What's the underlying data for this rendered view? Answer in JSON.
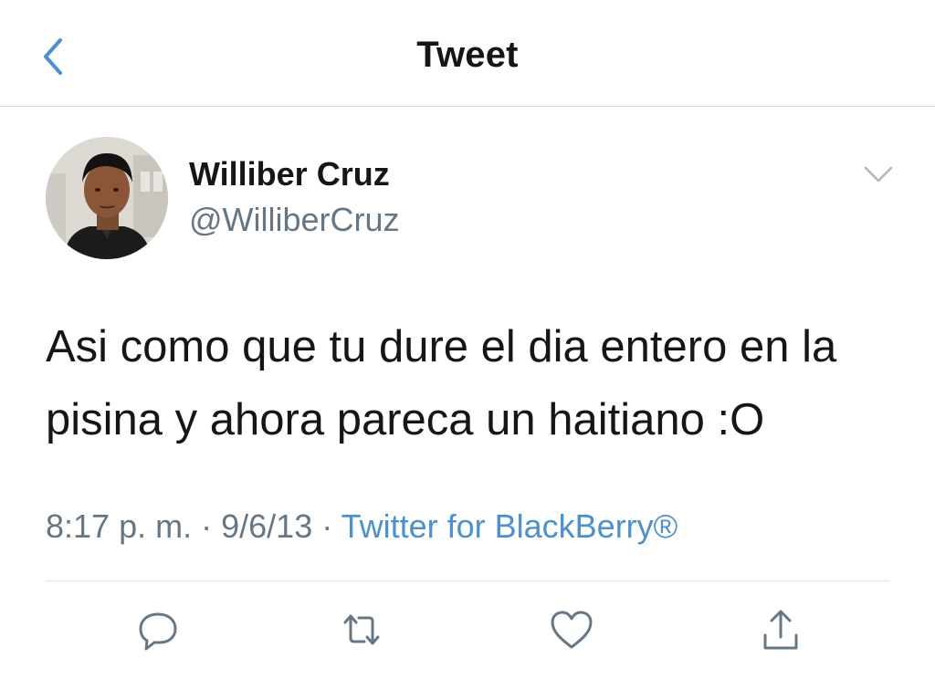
{
  "header": {
    "title": "Tweet",
    "back_icon": "chevron-left-icon"
  },
  "author": {
    "name": "Williber Cruz",
    "handle": "@WilliberCruz",
    "avatar": "profile-photo",
    "menu_icon": "chevron-down-icon"
  },
  "tweet": {
    "text": "Asi como que tu dure el dia entero en la pisina y ahora pareca un haitiano :O",
    "time": "8:17 p. m.",
    "separator": "·",
    "date": "9/6/13",
    "source": "Twitter for BlackBerry®"
  },
  "actions": [
    {
      "icon": "reply-icon"
    },
    {
      "icon": "retweet-icon"
    },
    {
      "icon": "like-icon"
    },
    {
      "icon": "share-icon"
    }
  ],
  "colors": {
    "accent": "#4a90d2",
    "text": "#14171a",
    "secondary": "#657786",
    "divider": "#e1e4e7"
  }
}
